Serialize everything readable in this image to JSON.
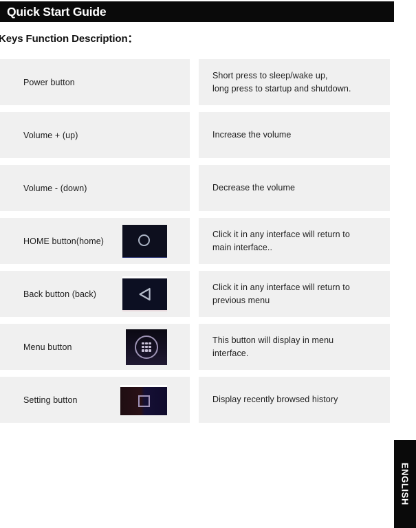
{
  "header": {
    "title": "Quick Start Guide"
  },
  "section": {
    "heading": "Keys Function Description："
  },
  "table": {
    "rows": [
      {
        "key": "Power button",
        "description": "Short press to sleep/wake up,\nlong press to startup and shutdown.",
        "icon": null
      },
      {
        "key": "Volume + (up)",
        "description": "Increase the volume",
        "icon": null
      },
      {
        "key": "Volume - (down)",
        "description": "Decrease the volume",
        "icon": null
      },
      {
        "key": "HOME button(home)",
        "description": "Click it in any interface will return to\nmain interface..",
        "icon": "home-circle-icon"
      },
      {
        "key": "Back button (back)",
        "description": "Click it in any interface will return to\nprevious menu",
        "icon": "back-triangle-icon"
      },
      {
        "key": "Menu button",
        "description": "This button will display in menu\ninterface.",
        "icon": "menu-grid-icon"
      },
      {
        "key": "Setting button",
        "description": "Display recently browsed history",
        "icon": "setting-square-icon"
      }
    ]
  },
  "language_tab": {
    "label": "ENGLISH"
  },
  "colors": {
    "header_bar": "#0a0a0a",
    "cell_background": "#f0f0f0",
    "text": "#1d1d1d",
    "page_background": "#ffffff",
    "icon_dark_navy": "#0d0f1e",
    "icon_glyph": "#aab3c4"
  }
}
